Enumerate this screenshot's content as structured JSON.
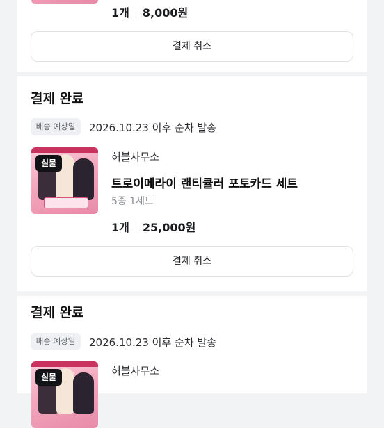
{
  "orders": [
    {
      "quantity": "1개",
      "price": "8,000원",
      "cancel_label": "결제 취소"
    },
    {
      "status": "결제 완료",
      "ship_chip": "배송 예상일",
      "ship_text": "2026.10.23 이후 순차 발송",
      "badge": "실물",
      "seller": "허블사무소",
      "product_name": "트로이메라이 랜티큘러 포토카드 세트",
      "option": "5종 1세트",
      "quantity": "1개",
      "price": "25,000원",
      "cancel_label": "결제 취소"
    },
    {
      "status": "결제 완료",
      "ship_chip": "배송 예상일",
      "ship_text": "2026.10.23 이후 순차 발송",
      "badge": "실물",
      "seller": "허블사무소"
    }
  ]
}
